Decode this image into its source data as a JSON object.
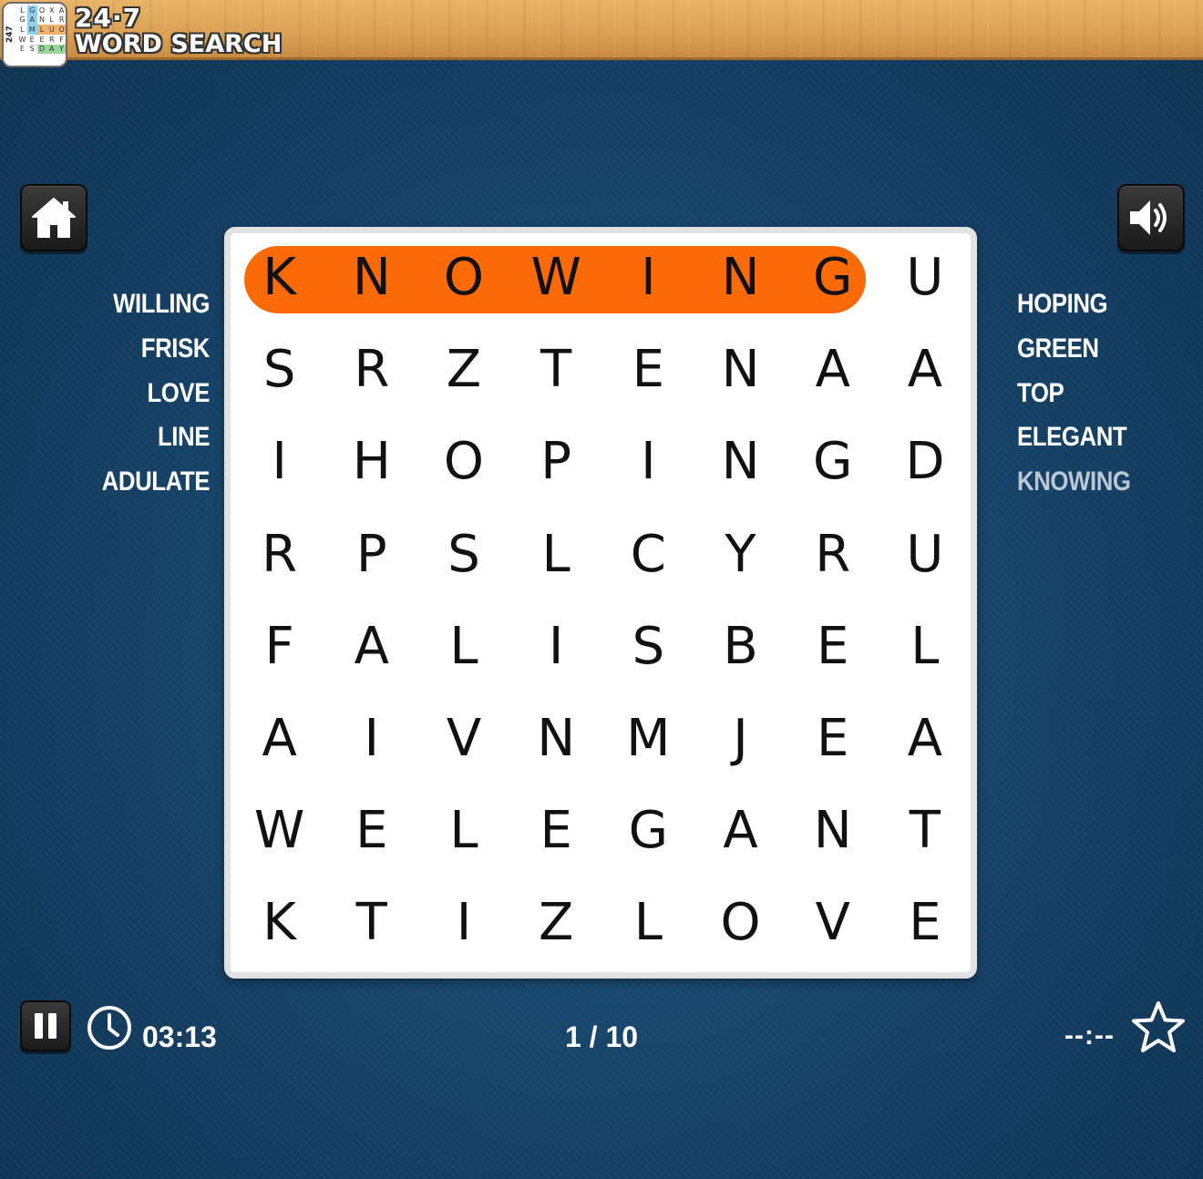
{
  "header": {
    "logo_side_text": "247",
    "logo_letters": [
      "L",
      "G",
      "O",
      "X",
      "A",
      "G",
      "A",
      "N",
      "L",
      "R",
      "L",
      "M",
      "L",
      "U",
      "O",
      "W",
      "E",
      "E",
      "R",
      "F",
      "E",
      "S",
      "D",
      "A",
      "Y"
    ],
    "brand_line1": "24·7",
    "brand_line2": "WORD SEARCH",
    "colors": {
      "wood": "#dca255",
      "logo_highlight_blue": "#8fd0ef",
      "logo_highlight_orange": "#f2b26b",
      "logo_highlight_green": "#9bd79b"
    }
  },
  "controls": {
    "home_icon": "home-icon",
    "sound_icon": "speaker-volume-icon",
    "pause_icon": "pause-icon"
  },
  "words_left": [
    {
      "text": "WILLING",
      "found": false
    },
    {
      "text": "FRISK",
      "found": false
    },
    {
      "text": "LOVE",
      "found": false
    },
    {
      "text": "LINE",
      "found": false
    },
    {
      "text": "ADULATE",
      "found": false
    }
  ],
  "words_right": [
    {
      "text": "HOPING",
      "found": false
    },
    {
      "text": "GREEN",
      "found": false
    },
    {
      "text": "TOP",
      "found": false
    },
    {
      "text": "ELEGANT",
      "found": false
    },
    {
      "text": "KNOWING",
      "found": true
    }
  ],
  "grid": [
    [
      "K",
      "N",
      "O",
      "W",
      "I",
      "N",
      "G",
      "U"
    ],
    [
      "S",
      "R",
      "Z",
      "T",
      "E",
      "N",
      "A",
      "A"
    ],
    [
      "I",
      "H",
      "O",
      "P",
      "I",
      "N",
      "G",
      "D"
    ],
    [
      "R",
      "P",
      "S",
      "L",
      "C",
      "Y",
      "R",
      "U"
    ],
    [
      "F",
      "A",
      "L",
      "I",
      "S",
      "B",
      "E",
      "L"
    ],
    [
      "A",
      "I",
      "V",
      "N",
      "M",
      "J",
      "E",
      "A"
    ],
    [
      "W",
      "E",
      "L",
      "E",
      "G",
      "A",
      "N",
      "T"
    ],
    [
      "K",
      "T",
      "I",
      "Z",
      "L",
      "O",
      "V",
      "E"
    ]
  ],
  "highlight": {
    "word": "KNOWING",
    "row": 0,
    "col_start": 0,
    "col_end": 6,
    "color": "#fa6b08"
  },
  "status": {
    "timer": "03:13",
    "progress": "1 / 10",
    "best_time": "--:--",
    "timer_icon": "clock-icon",
    "best_icon": "star-icon"
  }
}
